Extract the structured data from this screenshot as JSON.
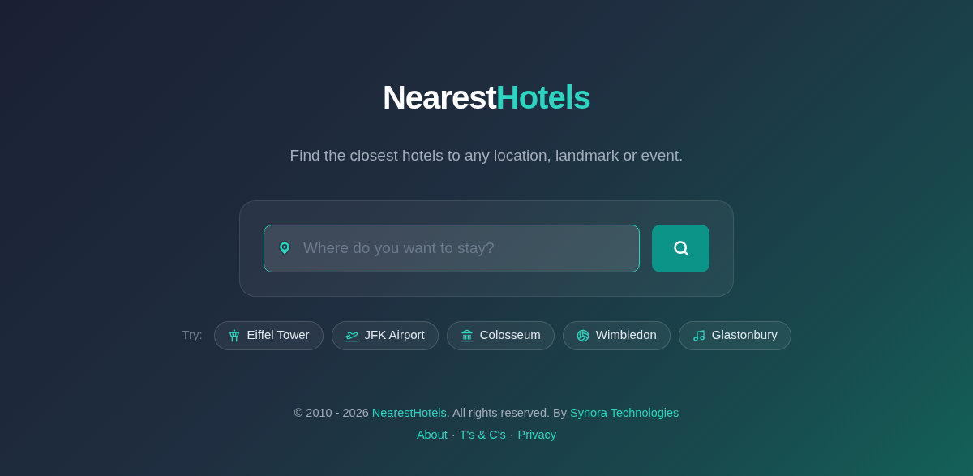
{
  "logo": {
    "first": "Nearest",
    "second": "Hotels"
  },
  "tagline": "Find the closest hotels to any location, landmark or event.",
  "search": {
    "placeholder": "Where do you want to stay?"
  },
  "suggestions": {
    "label": "Try:",
    "items": [
      {
        "label": "Eiffel Tower",
        "kind": "tower"
      },
      {
        "label": "JFK Airport",
        "kind": "plane"
      },
      {
        "label": "Colosseum",
        "kind": "landmark"
      },
      {
        "label": "Wimbledon",
        "kind": "ball"
      },
      {
        "label": "Glastonbury",
        "kind": "music"
      }
    ]
  },
  "footer": {
    "copyright": [
      {
        "kind": "text",
        "text": "© 2010 - 2026 "
      },
      {
        "kind": "link",
        "text": "NearestHotels"
      },
      {
        "kind": "text",
        "text": ". All rights reserved. By "
      },
      {
        "kind": "link",
        "text": "Synora Technologies"
      }
    ],
    "links": [
      "About",
      "T's & C's",
      "Privacy"
    ],
    "separators": [
      "·",
      "·"
    ]
  }
}
